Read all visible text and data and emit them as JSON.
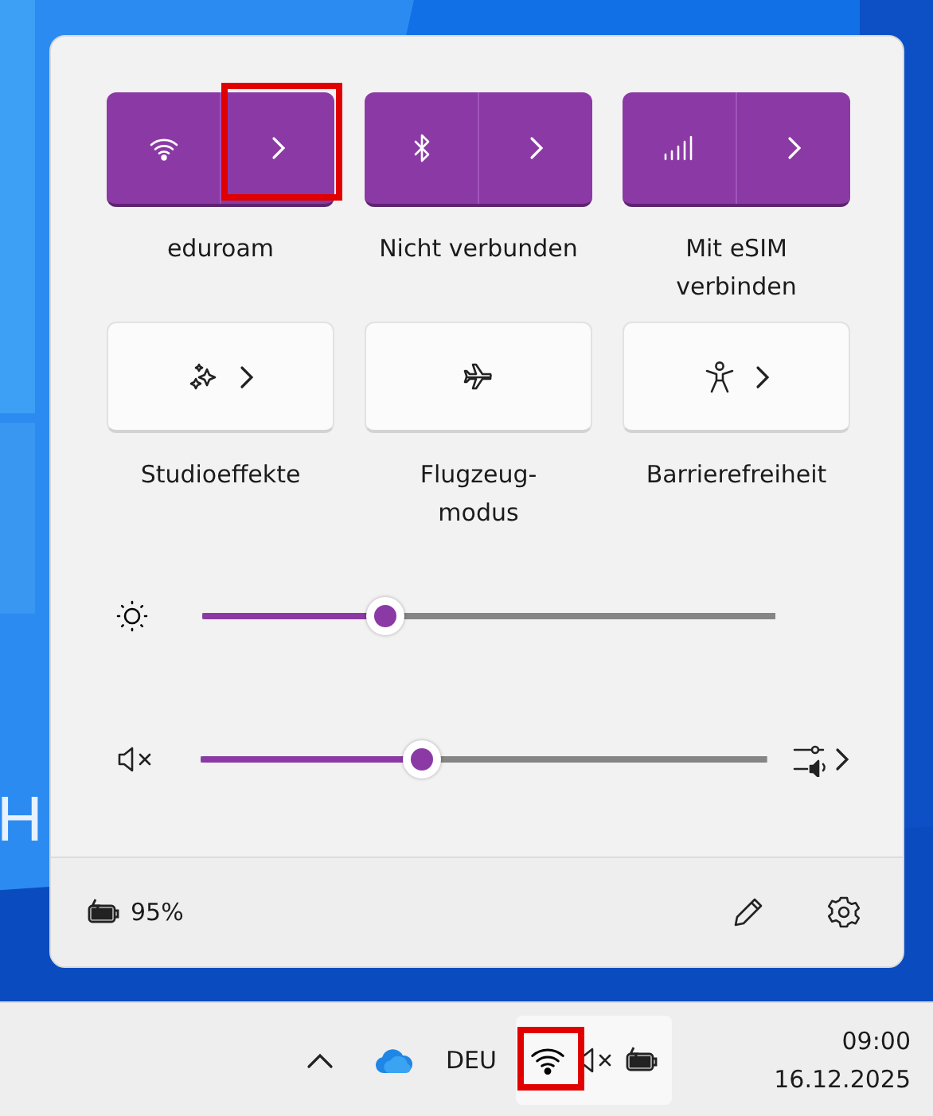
{
  "desktop": {
    "text": "H"
  },
  "quick_tiles": [
    {
      "kind": "split",
      "label": "eduroam",
      "on": true,
      "highlighted": true
    },
    {
      "kind": "split",
      "label": "Nicht verbunden",
      "on": true,
      "highlighted": false
    },
    {
      "kind": "split",
      "label": "Mit eSIM\nverbinden",
      "on": true,
      "highlighted": false
    },
    {
      "kind": "tile",
      "label": "Studioeffekte",
      "on": false,
      "has_arrow": true
    },
    {
      "kind": "tile",
      "label": "Flugzeug-\nmodus",
      "on": false,
      "has_arrow": false
    },
    {
      "kind": "tile",
      "label": "Barrierefreiheit",
      "on": false,
      "has_arrow": true
    }
  ],
  "sliders": [
    {
      "kind": "brightness",
      "level": 0.32
    },
    {
      "kind": "volume",
      "level": 0.39,
      "muted": true
    }
  ],
  "footer": {
    "battery": "95%"
  },
  "taskbar": {
    "language": "DEU",
    "time": "09:00",
    "date": "16.12.2025",
    "wifi_highlighted": true
  }
}
